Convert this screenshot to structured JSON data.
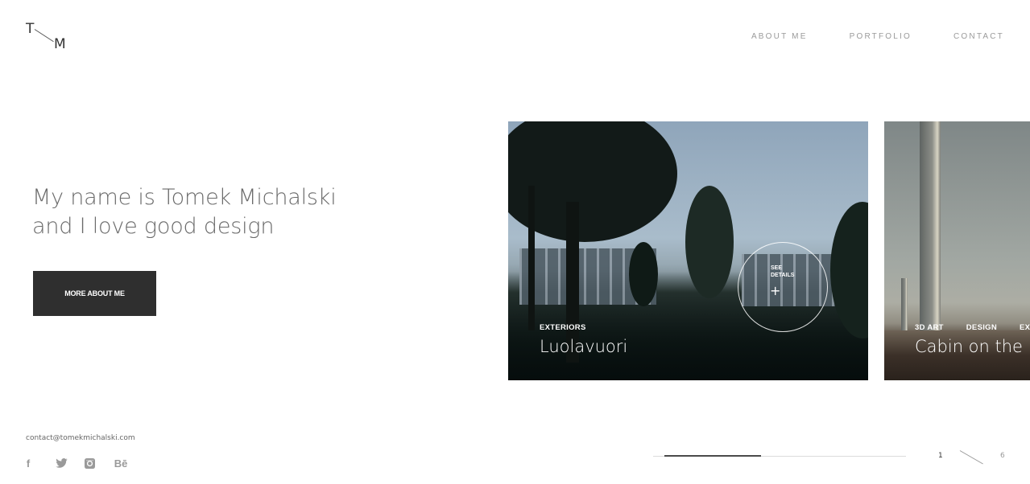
{
  "logo": {
    "first": "T",
    "second": "M"
  },
  "nav": {
    "items": [
      {
        "label": "ABOUT ME"
      },
      {
        "label": "PORTFOLIO"
      },
      {
        "label": "CONTACT"
      }
    ]
  },
  "hero": {
    "line1": "My name is Tomek Michalski",
    "line2": "and I love good design",
    "button_label": "MORE ABOUT ME"
  },
  "slides": [
    {
      "categories": [
        "EXTERIORS"
      ],
      "title": "Luolavuori",
      "see_details": "SEE DETAILS",
      "plus_icon": "+"
    },
    {
      "categories": [
        "3D ART",
        "DESIGN",
        "EXTERIORS"
      ],
      "title": "Cabin on the Moon"
    }
  ],
  "footer": {
    "email": "contact@tomekmichalski.com",
    "socials": [
      {
        "name": "facebook-icon",
        "glyph": "f"
      },
      {
        "name": "twitter-icon",
        "glyph": ""
      },
      {
        "name": "instagram-icon",
        "glyph": ""
      },
      {
        "name": "behance-icon",
        "glyph": "Bē"
      }
    ]
  },
  "slider": {
    "current": "1",
    "total": "6",
    "progress_fraction": 0.4
  }
}
